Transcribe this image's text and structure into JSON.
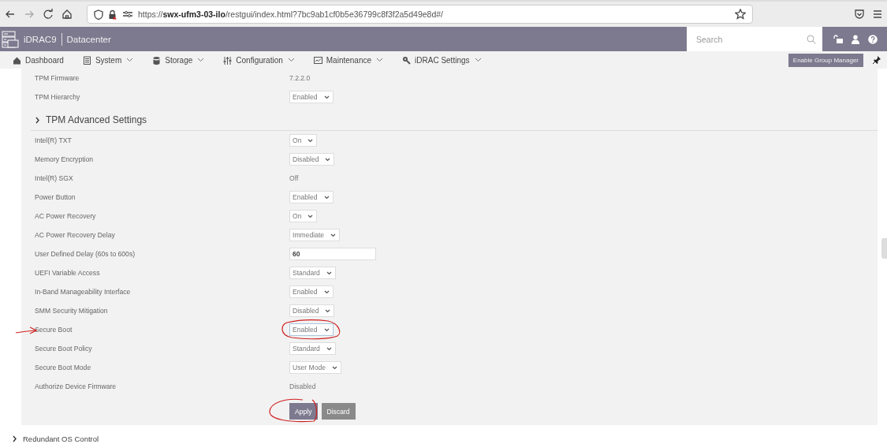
{
  "browser": {
    "url": "https://**swx-ufm3-03-ilo**/restgui/index.html?7bc9ab1cf0b5e36799c8f3f2a5d49e8d#/"
  },
  "header": {
    "product": "iDRAC9",
    "edition": "Datacenter",
    "search": {
      "placeholder": "Search"
    }
  },
  "nav": {
    "items": [
      {
        "label": "Dashboard",
        "dropdown": false
      },
      {
        "label": "System",
        "dropdown": true
      },
      {
        "label": "Storage",
        "dropdown": true
      },
      {
        "label": "Configuration",
        "dropdown": true
      },
      {
        "label": "Maintenance",
        "dropdown": true
      },
      {
        "label": "iDRAC Settings",
        "dropdown": true
      }
    ],
    "group_manager_button": "Enable Group Manager"
  },
  "settings": {
    "top_rows": [
      {
        "kind": "text",
        "label": "TPM Firmware",
        "value": "7.2.2.0"
      },
      {
        "kind": "select",
        "label": "TPM Hierarchy",
        "value": "Enabled",
        "focused": false
      }
    ],
    "section": {
      "title": "TPM Advanced Settings",
      "expanded": false
    },
    "rows": [
      {
        "kind": "select",
        "label": "Intel(R) TXT",
        "value": "On",
        "focused": false
      },
      {
        "kind": "select",
        "label": "Memory Encryption",
        "value": "Disabled",
        "focused": false
      },
      {
        "kind": "text",
        "label": "Intel(R) SGX",
        "value": "Off"
      },
      {
        "kind": "select",
        "label": "Power Button",
        "value": "Enabled",
        "focused": false
      },
      {
        "kind": "select",
        "label": "AC Power Recovery",
        "value": "On",
        "focused": false
      },
      {
        "kind": "select",
        "label": "AC Power Recovery Delay",
        "value": "Immediate",
        "focused": false
      },
      {
        "kind": "input",
        "label": "User Defined Delay (60s to 600s)",
        "value": "60"
      },
      {
        "kind": "select",
        "label": "UEFI Variable Access",
        "value": "Standard",
        "focused": false
      },
      {
        "kind": "select",
        "label": "In-Band Manageability Interface",
        "value": "Enabled",
        "focused": false
      },
      {
        "kind": "select",
        "label": "SMM Security Mitigation",
        "value": "Disabled",
        "focused": false
      },
      {
        "kind": "select",
        "label": "Secure Boot",
        "value": "Enabled",
        "focused": true
      },
      {
        "kind": "select",
        "label": "Secure Boot Policy",
        "value": "Standard",
        "focused": false
      },
      {
        "kind": "select",
        "label": "Secure Boot Mode",
        "value": "User Mode",
        "focused": false
      },
      {
        "kind": "text",
        "label": "Authorize Device Firmware",
        "value": "Disabled"
      }
    ],
    "buttons": [
      {
        "label": "Apply",
        "kind": "primary"
      },
      {
        "label": "Discard",
        "kind": "secondary"
      }
    ]
  },
  "next_section": {
    "title": "Redundant OS Control",
    "expanded": false
  }
}
